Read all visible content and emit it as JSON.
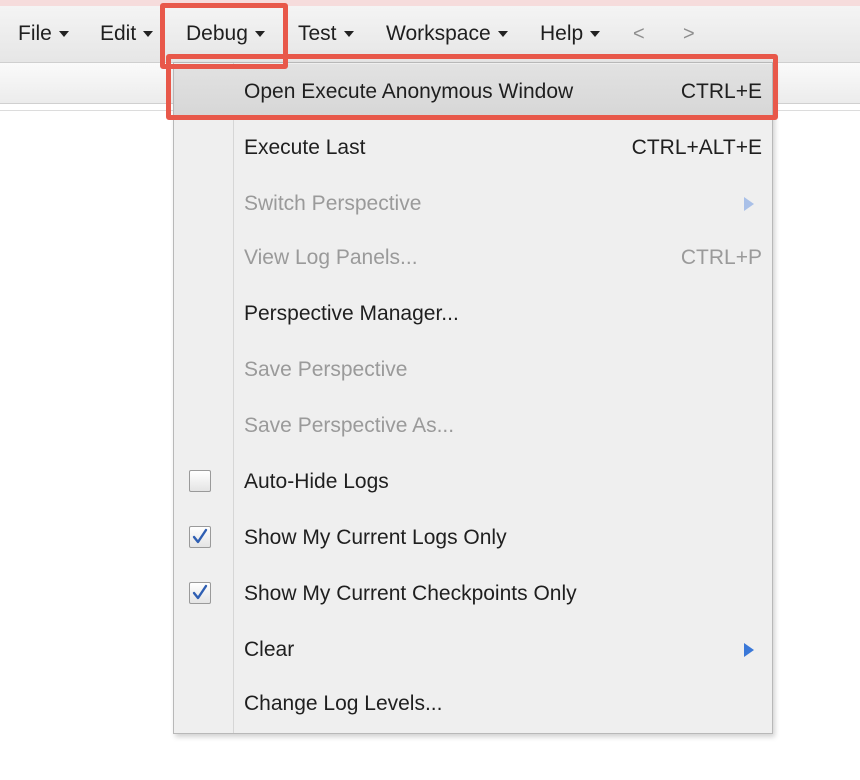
{
  "menubar": {
    "menus": [
      {
        "label": "File"
      },
      {
        "label": "Edit"
      },
      {
        "label": "Debug"
      },
      {
        "label": "Test"
      },
      {
        "label": "Workspace"
      },
      {
        "label": "Help"
      }
    ],
    "back_arrow": "<",
    "forward_arrow": ">"
  },
  "debug_menu": {
    "items": [
      {
        "label": "Open Execute Anonymous Window",
        "shortcut": "CTRL+E",
        "enabled": true,
        "highlighted": true
      },
      {
        "label": "Execute Last",
        "shortcut": "CTRL+ALT+E",
        "enabled": true
      },
      {
        "label": "Switch Perspective",
        "enabled": false,
        "submenu": true
      },
      {
        "label": "View Log Panels...",
        "shortcut": "CTRL+P",
        "enabled": false
      },
      {
        "label": "Perspective Manager...",
        "enabled": true
      },
      {
        "label": "Save Perspective",
        "enabled": false
      },
      {
        "label": "Save Perspective As...",
        "enabled": false
      },
      {
        "label": "Auto-Hide Logs",
        "enabled": true,
        "checkbox": true,
        "checked": false
      },
      {
        "label": "Show My Current Logs Only",
        "enabled": true,
        "checkbox": true,
        "checked": true
      },
      {
        "label": "Show My Current Checkpoints Only",
        "enabled": true,
        "checkbox": true,
        "checked": true
      },
      {
        "label": "Clear",
        "enabled": true,
        "submenu": true
      },
      {
        "label": "Change Log Levels...",
        "enabled": true
      }
    ]
  },
  "colors": {
    "highlight_border": "#e8584a",
    "submenu_arrow": "#3a78d8",
    "checkmark": "#2f5fb3",
    "disabled_text": "#9a9a9a"
  }
}
